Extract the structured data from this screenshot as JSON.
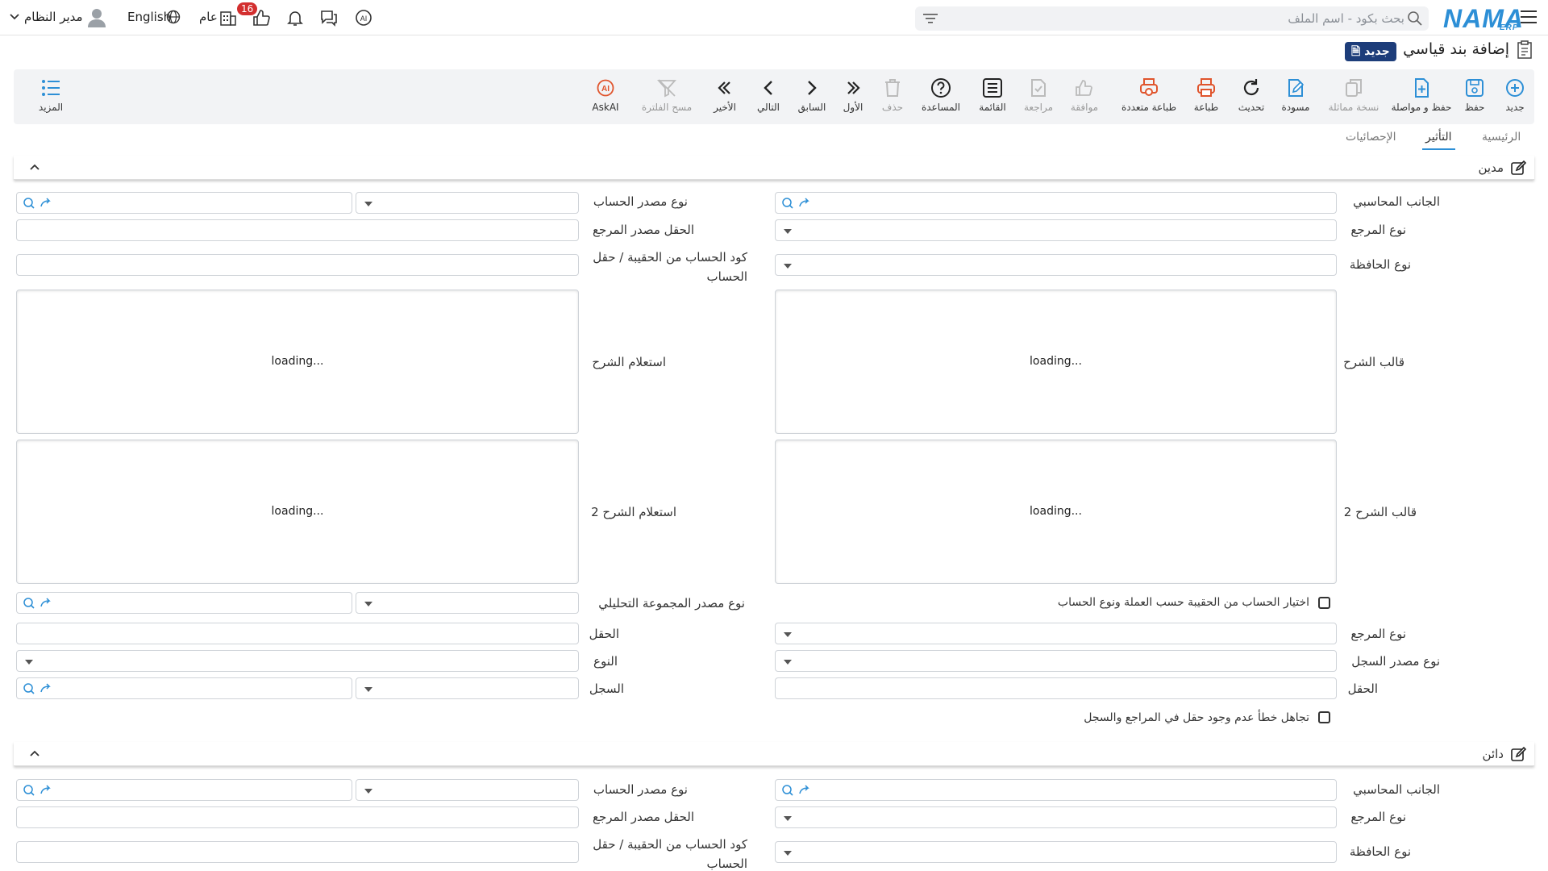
{
  "header": {
    "brand": "NAMA",
    "brand_sub": "ERP",
    "search_placeholder": "بحث بكود - اسم الملف",
    "user": "مدير النظام",
    "language": "English",
    "scope": "عام",
    "notifications_count": "16"
  },
  "page": {
    "title": "إضافة بند قياسي",
    "new_tag": "جديد"
  },
  "toolbar": {
    "new": "جديد",
    "save": "حفظ",
    "save_continue": "حفظ و مواصلة",
    "duplicate": "نسخة مماثلة",
    "draft": "مسودة",
    "refresh": "تحديث",
    "print": "طباعة",
    "multi_print": "طباعة متعددة",
    "approve": "موافقة",
    "review": "مراجعة",
    "list": "القائمة",
    "help": "المساعدة",
    "delete": "حذف",
    "first": "الأول",
    "previous": "السابق",
    "next": "التالي",
    "last": "الأخير",
    "clear_filter": "مسح الفلترة",
    "askai": "AskAI",
    "more": "المزيد"
  },
  "tabs": [
    "الرئيسية",
    "التأثير",
    "الإحصائيات"
  ],
  "debit": {
    "title": "مدين",
    "accounting_side": "الجانب المحاسبي",
    "account_source_type": "نوع مصدر الحساب",
    "reference_type": "نوع المرجع",
    "reference_source_field": "الحقل مصدر المرجع",
    "wallet_type": "نوع الحافظة",
    "account_code_line1": "كود الحساب من الحقيبة / حقل",
    "account_code_line2": "الحساب",
    "desc_template": "قالب الشرح",
    "desc_query": "استعلام الشرح",
    "desc_template2": "قالب الشرح 2",
    "desc_query2": "استعلام الشرح 2",
    "loading": "loading...",
    "analytic_group_source": "نوع مصدر المجموعة التحليلي",
    "choose_account_check": "اختيار الحساب من الحقيبة حسب العملة ونوع الحساب",
    "reference_type2": "نوع المرجع",
    "field": "الحقل",
    "record_source_type": "نوع مصدر السجل",
    "type": "النوع",
    "field2": "الحقل",
    "record": "السجل",
    "ignore_error_check": "تجاهل خطأ عدم وجود حقل في المراجع والسجل"
  },
  "credit": {
    "title": "دائن",
    "accounting_side": "الجانب المحاسبي",
    "account_source_type": "نوع مصدر الحساب",
    "reference_type": "نوع المرجع",
    "reference_source_field": "الحقل مصدر المرجع",
    "wallet_type": "نوع الحافظة",
    "account_code_line1": "كود الحساب من الحقيبة / حقل",
    "account_code_line2": "الحساب"
  },
  "colors": {
    "accent": "#2d8fd6",
    "tag": "#1d3d7a",
    "print": "#e0542c",
    "badge": "#d32f2f"
  }
}
